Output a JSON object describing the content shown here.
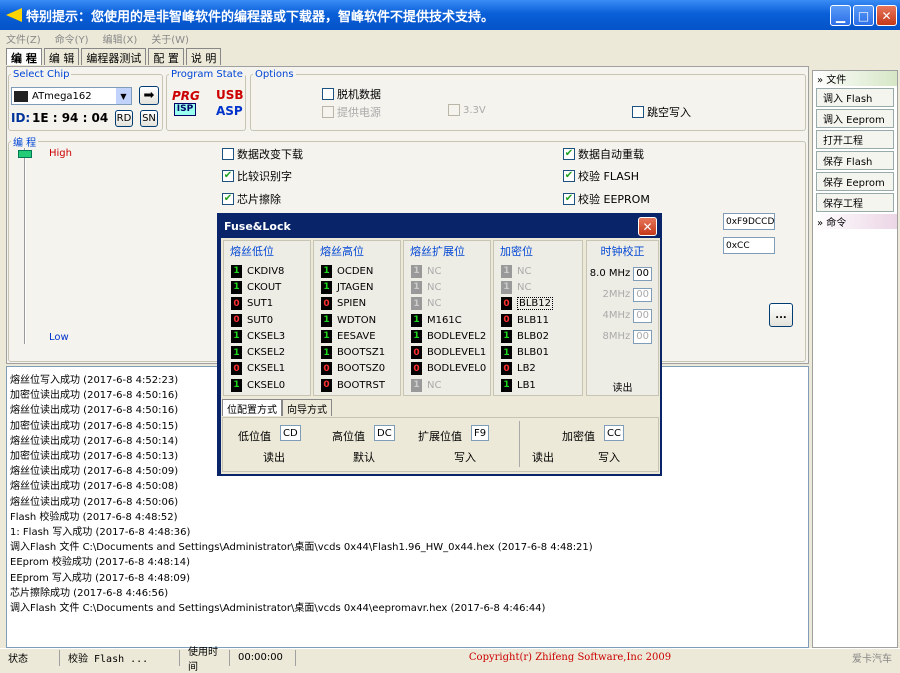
{
  "window": {
    "title": "特别提示：您使用的是非智峰软件的编程器或下载器，智峰软件不提供技术支持。",
    "min": "▁",
    "max": "□",
    "close": "✕"
  },
  "menu": [
    "文件(Z)",
    "命令(Y)",
    "编辑(X)",
    "关于(W)"
  ],
  "tabs": [
    "编 程",
    "编 辑",
    "编程器测试",
    "配 置",
    "说 明"
  ],
  "select_chip": {
    "legend": "Select Chip",
    "chip": "ATmega162",
    "arrow": "➡",
    "id_label": "ID:",
    "id_value": "1E : 94 : 04",
    "rd": "RD",
    "sn": "SN"
  },
  "program_state": {
    "legend": "Program State",
    "prg": "PRG",
    "isp": "ISP",
    "usb": "USB",
    "asp": "ASP"
  },
  "options": {
    "legend": "Options",
    "offline": "脱机数据",
    "power": "提供电源",
    "v33": "3.3V",
    "skip": "跳空写入"
  },
  "program": {
    "legend": "编 程",
    "high": "High",
    "low": "Low",
    "opt1": "数据改变下载",
    "opt2": "比较识别字",
    "opt3": "芯片擦除",
    "opt4": "数据自动重载",
    "opt5": "校验 FLASH",
    "opt6": "校验 EEPROM",
    "hex1": "0xF9DCCD",
    "hex2": "0xCC",
    "more": "..."
  },
  "log": [
    "熔丝位写入成功 (2017-6-8 4:52:23)",
    "加密位读出成功 (2017-6-8 4:50:16)",
    "熔丝位读出成功 (2017-6-8 4:50:16)",
    "加密位读出成功 (2017-6-8 4:50:15)",
    "熔丝位读出成功 (2017-6-8 4:50:14)",
    "加密位读出成功 (2017-6-8 4:50:13)",
    "熔丝位读出成功 (2017-6-8 4:50:09)",
    "熔丝位读出成功 (2017-6-8 4:50:08)",
    "熔丝位读出成功 (2017-6-8 4:50:06)",
    "Flash 校验成功 (2017-6-8 4:48:52)",
    "1: Flash 写入成功 (2017-6-8 4:48:36)",
    "调入Flash 文件 C:\\Documents and Settings\\Administrator\\桌面\\vcds 0x44\\Flash1.96_HW_0x44.hex (2017-6-8 4:48:21)",
    "EEprom 校验成功 (2017-6-8 4:48:14)",
    "EEprom 写入成功 (2017-6-8 4:48:09)",
    "芯片擦除成功 (2017-6-8 4:46:56)",
    "调入Flash 文件 C:\\Documents and Settings\\Administrator\\桌面\\vcds 0x44\\eepromavr.hex (2017-6-8 4:46:44)"
  ],
  "right": {
    "file_head": "文件",
    "buttons": [
      "调入 Flash",
      "调入 Eeprom",
      "打开工程",
      "保存 Flash",
      "保存 Eeprom",
      "保存工程"
    ],
    "cmd_head": "命令"
  },
  "status": {
    "state": "状态",
    "verify": "校验 Flash ...",
    "time_label": "使用时间",
    "time": "00:00:00",
    "copyright": "Copyright(r) Zhifeng Software,Inc 2009",
    "watermark": "爱卡汽车"
  },
  "dialog": {
    "title": "Fuse&Lock",
    "close": "✕",
    "cols": [
      {
        "title": "熔丝低位",
        "bits": [
          {
            "v": "1",
            "n": "CKDIV8"
          },
          {
            "v": "1",
            "n": "CKOUT"
          },
          {
            "v": "0",
            "n": "SUT1"
          },
          {
            "v": "0",
            "n": "SUT0"
          },
          {
            "v": "1",
            "n": "CKSEL3"
          },
          {
            "v": "1",
            "n": "CKSEL2"
          },
          {
            "v": "0",
            "n": "CKSEL1"
          },
          {
            "v": "1",
            "n": "CKSEL0"
          }
        ]
      },
      {
        "title": "熔丝高位",
        "bits": [
          {
            "v": "1",
            "n": "OCDEN"
          },
          {
            "v": "1",
            "n": "JTAGEN"
          },
          {
            "v": "0",
            "n": "SPIEN"
          },
          {
            "v": "1",
            "n": "WDTON"
          },
          {
            "v": "1",
            "n": "EESAVE"
          },
          {
            "v": "1",
            "n": "BOOTSZ1"
          },
          {
            "v": "0",
            "n": "BOOTSZ0"
          },
          {
            "v": "0",
            "n": "BOOTRST"
          }
        ]
      },
      {
        "title": "熔丝扩展位",
        "bits": [
          {
            "v": "1",
            "n": "NC"
          },
          {
            "v": "1",
            "n": "NC"
          },
          {
            "v": "1",
            "n": "NC"
          },
          {
            "v": "1",
            "n": "M161C"
          },
          {
            "v": "1",
            "n": "BODLEVEL2"
          },
          {
            "v": "0",
            "n": "BODLEVEL1"
          },
          {
            "v": "0",
            "n": "BODLEVEL0"
          },
          {
            "v": "1",
            "n": "NC"
          }
        ]
      },
      {
        "title": "加密位",
        "bits": [
          {
            "v": "1",
            "n": "NC"
          },
          {
            "v": "1",
            "n": "NC"
          },
          {
            "v": "0",
            "n": "BLB12"
          },
          {
            "v": "0",
            "n": "BLB11"
          },
          {
            "v": "1",
            "n": "BLB02"
          },
          {
            "v": "1",
            "n": "BLB01"
          },
          {
            "v": "0",
            "n": "LB2"
          },
          {
            "v": "1",
            "n": "LB1"
          }
        ]
      }
    ],
    "clock": {
      "title": "时钟校正",
      "rows": [
        {
          "f": "8.0 MHz",
          "v": "00"
        },
        {
          "f": "2MHz",
          "v": "00"
        },
        {
          "f": "4MHz",
          "v": "00"
        },
        {
          "f": "8MHz",
          "v": "00"
        }
      ],
      "read": "读出"
    },
    "tab1": "位配置方式",
    "tab2": "向导方式",
    "low_label": "低位值",
    "low": "CD",
    "high_label": "高位值",
    "high": "DC",
    "ext_label": "扩展位值",
    "ext": "F9",
    "lock_label": "加密值",
    "lock": "CC",
    "read": "读出",
    "default": "默认",
    "write": "写入",
    "read2": "读出",
    "write2": "写入"
  }
}
